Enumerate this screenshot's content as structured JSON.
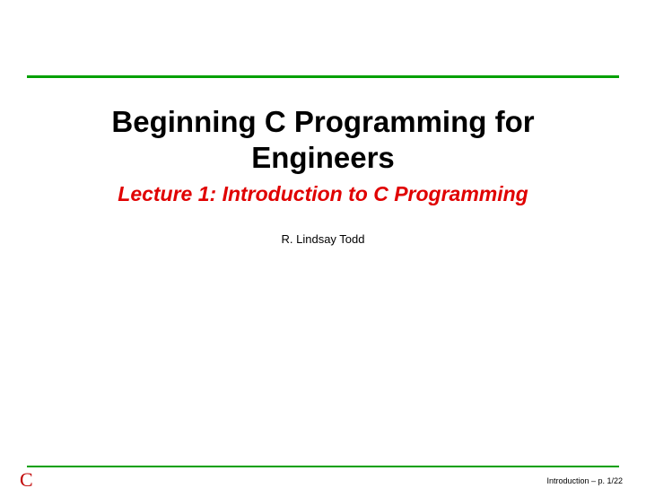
{
  "title_line1": "Beginning C Programming for",
  "title_line2": "Engineers",
  "subtitle": "Lecture 1: Introduction to C Programming",
  "author": "R. Lindsay Todd",
  "logo": "C",
  "page_label": "Introduction – p. 1/22",
  "colors": {
    "rule": "#00a000",
    "subtitle": "#e00000",
    "logo": "#c00000"
  }
}
